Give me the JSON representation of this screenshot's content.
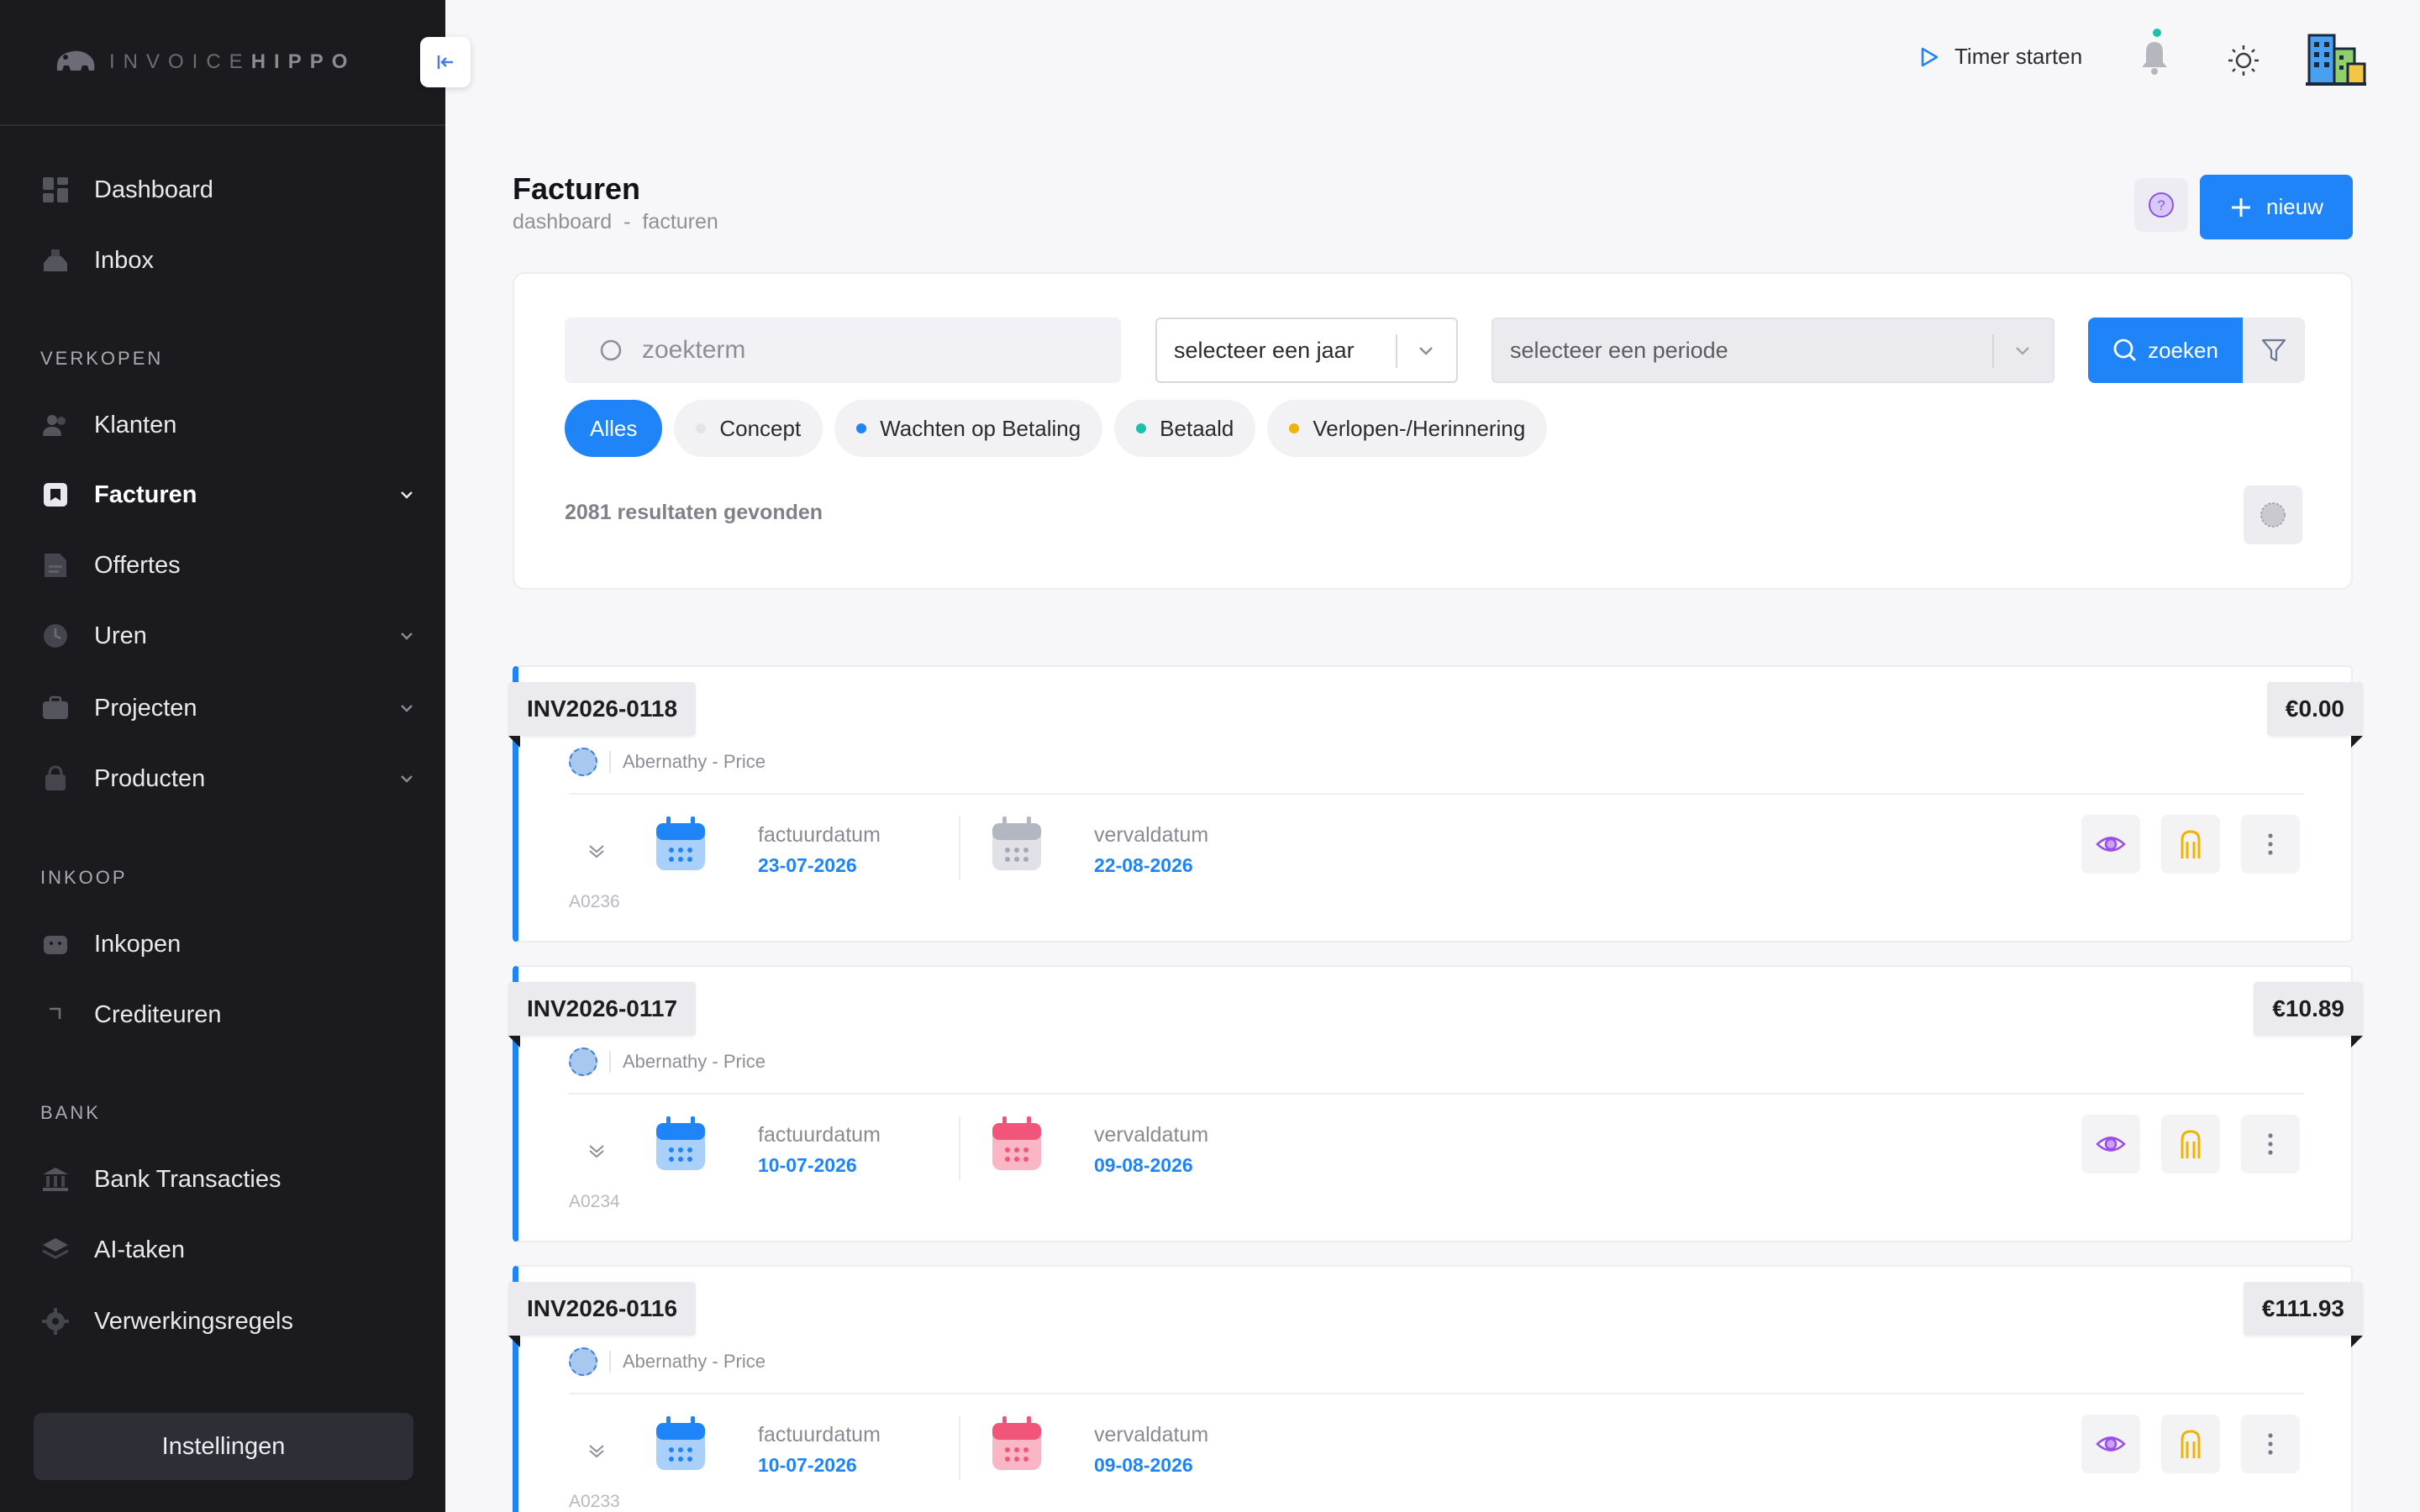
{
  "brand": {
    "logo_prefix": "INVOICE",
    "logo_suffix": "HIPPO"
  },
  "sidebar": {
    "items_top": [
      {
        "label": "Dashboard",
        "icon": "dashboard-icon"
      },
      {
        "label": "Inbox",
        "icon": "inbox-icon"
      }
    ],
    "sections": [
      {
        "label": "VERKOPEN",
        "items": [
          {
            "label": "Klanten",
            "icon": "users-icon"
          },
          {
            "label": "Facturen",
            "icon": "invoice-icon",
            "active": true,
            "chevron": true
          },
          {
            "label": "Offertes",
            "icon": "quote-icon"
          },
          {
            "label": "Uren",
            "icon": "clock-icon",
            "chevron": true
          },
          {
            "label": "Projecten",
            "icon": "briefcase-icon",
            "chevron": true
          },
          {
            "label": "Producten",
            "icon": "box-icon",
            "chevron": true
          }
        ]
      },
      {
        "label": "INKOOP",
        "items": [
          {
            "label": "Inkopen",
            "icon": "cart-icon"
          },
          {
            "label": "Crediteuren",
            "icon": "arrow-up-left-icon"
          }
        ]
      },
      {
        "label": "BANK",
        "items": [
          {
            "label": "Bank Transacties",
            "icon": "bank-icon"
          },
          {
            "label": "AI-taken",
            "icon": "layers-icon"
          },
          {
            "label": "Verwerkingsregels",
            "icon": "gear-icon"
          }
        ]
      }
    ],
    "settings_label": "Instellingen"
  },
  "topbar": {
    "timer_label": "Timer starten"
  },
  "page": {
    "title": "Facturen",
    "breadcrumb": [
      "dashboard",
      "-",
      "facturen"
    ],
    "new_label": "nieuw"
  },
  "filters": {
    "search_placeholder": "zoekterm",
    "year_placeholder": "selecteer een jaar",
    "period_placeholder": "selecteer een periode",
    "search_button": "zoeken",
    "pills": [
      {
        "label": "Alles",
        "active": true
      },
      {
        "label": "Concept",
        "color": "#e3e3e8"
      },
      {
        "label": "Wachten op Betaling",
        "color": "#1e84f7"
      },
      {
        "label": "Betaald",
        "color": "#1bc1a8"
      },
      {
        "label": "Verlopen-/Herinnering",
        "color": "#f0b400"
      }
    ],
    "results_text": "2081 resultaten gevonden"
  },
  "invoices": [
    {
      "number": "INV2026-0118",
      "amount": "€0.00",
      "client": "Abernathy - Price",
      "invoice_date_label": "factuurdatum",
      "invoice_date": "23-07-2026",
      "due_date_label": "vervaldatum",
      "due_date": "22-08-2026",
      "due_calendar_color": "#bfc3cc",
      "ref": "A0236"
    },
    {
      "number": "INV2026-0117",
      "amount": "€10.89",
      "client": "Abernathy - Price",
      "invoice_date_label": "factuurdatum",
      "invoice_date": "10-07-2026",
      "due_date_label": "vervaldatum",
      "due_date": "09-08-2026",
      "due_calendar_color": "#f2557a",
      "ref": "A0234"
    },
    {
      "number": "INV2026-0116",
      "amount": "€111.93",
      "client": "Abernathy - Price",
      "invoice_date_label": "factuurdatum",
      "invoice_date": "10-07-2026",
      "due_date_label": "vervaldatum",
      "due_date": "09-08-2026",
      "due_calendar_color": "#f2557a",
      "ref": "A0233"
    }
  ],
  "colors": {
    "accent": "#1e84f7",
    "sidebar_bg": "#1a1a1f",
    "success": "#1bc1a8",
    "warning": "#f0b400",
    "danger": "#f2557a"
  }
}
